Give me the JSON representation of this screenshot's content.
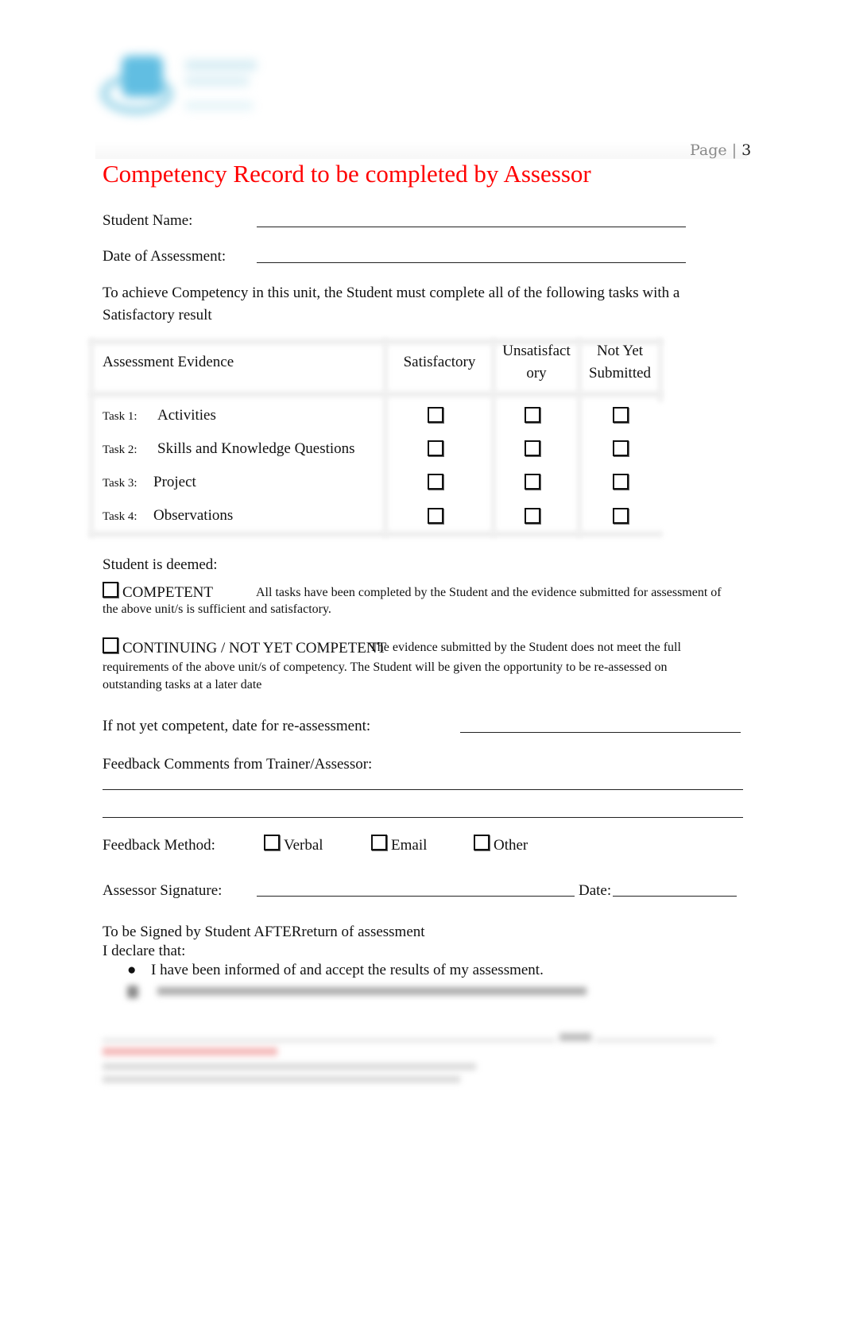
{
  "header": {
    "logo": "organisation-logo",
    "page_label": "Page |",
    "page_number": "3"
  },
  "title": "Competency Record to be completed by Assessor",
  "fields": {
    "student_name_label": "Student Name:",
    "date_of_assessment_label": "Date of Assessment:"
  },
  "intro": "To achieve Competency in this unit, the Student must complete all of the following tasks with a Satisfactory result",
  "table": {
    "headers": [
      "Assessment Evidence",
      "Satisfactory",
      "Unsatisfact ory",
      "Not Yet Submitted"
    ],
    "header_unsat_line1": "Unsatisfact",
    "header_unsat_line2": "ory",
    "header_nys_line1": "Not Yet",
    "header_nys_line2": "Submitted",
    "rows": [
      {
        "task": "Task 1:",
        "name": "Activities",
        "satisfactory": false,
        "unsatisfactory": false,
        "not_yet_submitted": false
      },
      {
        "task": "Task 2:",
        "name": "Skills and Knowledge Questions",
        "satisfactory": false,
        "unsatisfactory": false,
        "not_yet_submitted": false
      },
      {
        "task": "Task 3:",
        "name": "Project",
        "satisfactory": false,
        "unsatisfactory": false,
        "not_yet_submitted": false
      },
      {
        "task": "Task 4:",
        "name": "Observations",
        "satisfactory": false,
        "unsatisfactory": false,
        "not_yet_submitted": false
      }
    ]
  },
  "deemed": {
    "label": "Student is deemed:",
    "competent_label": "COMPETENT",
    "competent_desc_1": "All tasks have been completed by the Student and the evidence submitted for assessment of",
    "competent_desc_2": "the above unit/s is sufficient and satisfactory.",
    "nyc_label": "CONTINUING / NOT YET COMPETENT",
    "nyc_desc_1": "The evidence submitted by the Student does not meet the full",
    "nyc_desc_2": "requirements of the above unit/s of competency. The Student will be given the opportunity to be re-assessed on",
    "nyc_desc_3": "outstanding tasks at a later date",
    "competent_checked": false,
    "nyc_checked": false
  },
  "reassessment_label": "If not yet competent, date for re-assessment:",
  "feedback": {
    "comments_label": "Feedback Comments from Trainer/Assessor:",
    "method_label": "Feedback Method:",
    "methods": [
      {
        "label": "Verbal",
        "checked": false
      },
      {
        "label": "Email",
        "checked": false
      },
      {
        "label": "Other",
        "checked": false
      }
    ]
  },
  "assessor": {
    "signature_label": "Assessor Signature:",
    "date_label": "Date:"
  },
  "student_sign": {
    "heading": "To be Signed by Student AFTERreturn of assessment",
    "declare": "I declare that:",
    "bullets": [
      "I have been informed of and accept the results of my assessment."
    ]
  }
}
